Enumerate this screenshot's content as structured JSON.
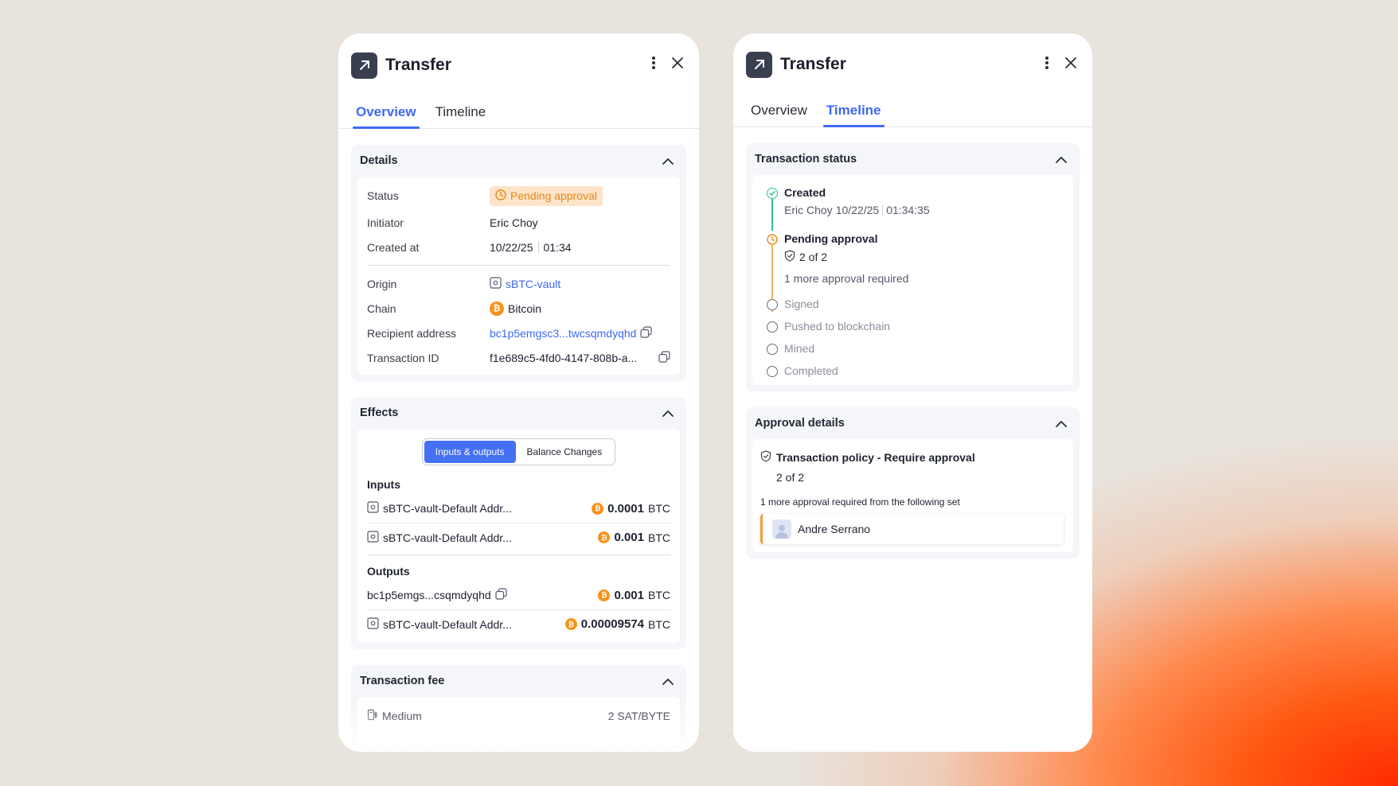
{
  "colors": {
    "accent": "#3f68f2",
    "pending": "#e48a17",
    "success": "#2fbf9a",
    "bitcoin": "#f7931a"
  },
  "left": {
    "title": "Transfer",
    "tabs": [
      "Overview",
      "Timeline"
    ],
    "details": {
      "heading": "Details",
      "rows": {
        "status_label": "Status",
        "status_value": "Pending approval",
        "initiator_label": "Initiator",
        "initiator_value": "Eric Choy",
        "created_label": "Created at",
        "created_date": "10/22/25",
        "created_time": "01:34",
        "origin_label": "Origin",
        "origin_value": "sBTC-vault",
        "chain_label": "Chain",
        "chain_value": "Bitcoin",
        "recipient_label": "Recipient address",
        "recipient_value": "bc1p5emgsc3...twcsqmdyqhd",
        "txid_label": "Transaction ID",
        "txid_value": "f1e689c5-4fd0-4147-808b-a..."
      }
    },
    "effects": {
      "heading": "Effects",
      "segments": [
        "Inputs & outputs",
        "Balance Changes"
      ],
      "inputs_label": "Inputs",
      "inputs": [
        {
          "name": "sBTC-vault-Default Addr...",
          "amount": "0.0001",
          "unit": "BTC"
        },
        {
          "name": "sBTC-vault-Default Addr...",
          "amount": "0.001",
          "unit": "BTC"
        }
      ],
      "outputs_label": "Outputs",
      "outputs": [
        {
          "name": "bc1p5emgs...csqmdyqhd",
          "amount": "0.001",
          "unit": "BTC"
        },
        {
          "name": "sBTC-vault-Default Addr...",
          "amount": "0.00009574",
          "unit": "BTC"
        }
      ]
    },
    "fee": {
      "heading": "Transaction fee",
      "speed": "Medium",
      "rate": "2 SAT/BYTE"
    }
  },
  "right": {
    "title": "Transfer",
    "tabs": [
      "Overview",
      "Timeline"
    ],
    "status": {
      "heading": "Transaction status",
      "created": {
        "title": "Created",
        "by": "Eric Choy",
        "date": "10/22/25",
        "time": "01:34:35"
      },
      "pending": {
        "title": "Pending approval",
        "count": "2 of 2",
        "note": "1 more approval required"
      },
      "steps": [
        "Signed",
        "Pushed to blockchain",
        "Mined",
        "Completed"
      ]
    },
    "approval": {
      "heading": "Approval details",
      "policy": "Transaction policy - Require approval",
      "count": "2 of 2",
      "note": "1 more approval required from the following set",
      "approver": "Andre Serrano"
    }
  }
}
